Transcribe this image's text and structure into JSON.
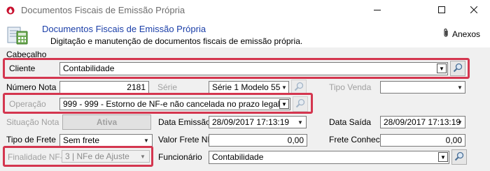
{
  "window": {
    "title": "Documentos Fiscais de Emissão Própria"
  },
  "header": {
    "title": "Documentos Fiscais de Emissão Própria",
    "subtitle": "Digitação e manutenção de documentos fiscais de emissão própria.",
    "anexos_label": "Anexos"
  },
  "section": {
    "label": "Cabeçalho"
  },
  "form": {
    "cliente": {
      "label": "Cliente",
      "value": "Contabilidade"
    },
    "numero_nota": {
      "label": "Número Nota",
      "value": "2181"
    },
    "serie": {
      "label": "Série",
      "value": "Série 1 Modelo 55"
    },
    "tipo_venda": {
      "label": "Tipo Venda",
      "value": ""
    },
    "operacao": {
      "label": "Operação",
      "value": "999   - 999 - Estorno de NF-e não cancelada no prazo legal"
    },
    "situacao_nota": {
      "label": "Situação Nota",
      "value": "Ativa"
    },
    "data_emissao": {
      "label": "Data Emissão",
      "value": "28/09/2017 17:13:19"
    },
    "data_saida": {
      "label": "Data Saída",
      "value": "28/09/2017 17:13:19"
    },
    "tipo_frete": {
      "label": "Tipo de Frete",
      "value": "Sem frete"
    },
    "valor_frete_nf": {
      "label": "Valor Frete NF",
      "value": "0,00"
    },
    "frete_conhec": {
      "label": "Frete Conhec.",
      "value": "0,00"
    },
    "finalidade": {
      "label": "Finalidade NF-e",
      "value": "3 | NFe de Ajuste"
    },
    "funcionario": {
      "label": "Funcionário",
      "value": "Contabilidade"
    }
  },
  "colors": {
    "highlight": "#d4364f",
    "header_title": "#1a3ea8"
  },
  "icons": [
    "app-drop-icon",
    "minimize-icon",
    "maximize-icon",
    "close-icon",
    "document-calculator-icon",
    "paperclip-icon",
    "search-icon",
    "chevron-down-icon"
  ]
}
